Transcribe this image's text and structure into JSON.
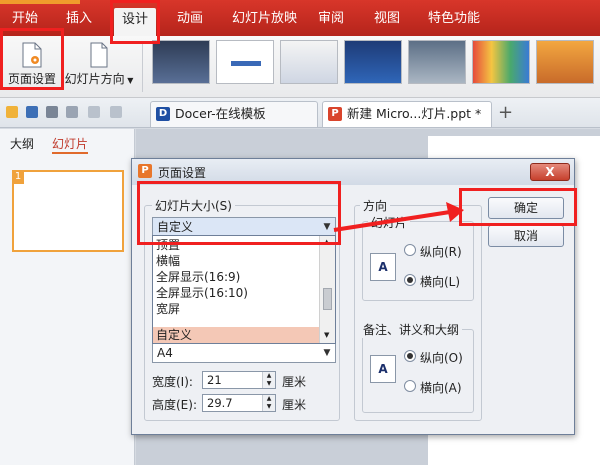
{
  "menu": {
    "tabs": [
      "开始",
      "插入",
      "设计",
      "动画",
      "幻灯片放映",
      "审阅",
      "视图",
      "特色功能"
    ],
    "active": "设计"
  },
  "ribbon": {
    "page_setup": "页面设置",
    "slide_orientation": "幻灯片方向"
  },
  "doc_tabs": [
    {
      "label": "Docer-在线模板",
      "icon": "docer-icon"
    },
    {
      "label": "新建 Micro...灯片.ppt *",
      "icon": "ppt-icon"
    }
  ],
  "left_panel": {
    "tabs": [
      "大纲",
      "幻灯片"
    ],
    "slide_number": "1"
  },
  "dialog": {
    "title": "页面设置",
    "close": "X",
    "slide_size_label": "幻灯片大小(S)",
    "slide_size_value": "自定义",
    "options": [
      "顶置",
      "横幅",
      "全屏显示(16:9)",
      "全屏显示(16:10)",
      "宽屏",
      "自定义"
    ],
    "paper_value": "A4",
    "width_label": "宽度(I):",
    "width_value": "21",
    "height_label": "高度(E):",
    "height_value": "29.7",
    "unit": "厘米",
    "orientation_label": "方向",
    "slides_label": "幻灯片",
    "portrait": "纵向(R)",
    "landscape": "横向(L)",
    "notes_label": "备注、讲义和大纲",
    "notes_portrait": "纵向(O)",
    "notes_landscape": "横向(A)",
    "orient_icon_letter": "A",
    "ok": "确定",
    "cancel": "取消"
  },
  "colors": {
    "accent": "#d8362a",
    "highlight": "#f02020",
    "selection": "#f4c8b6"
  }
}
